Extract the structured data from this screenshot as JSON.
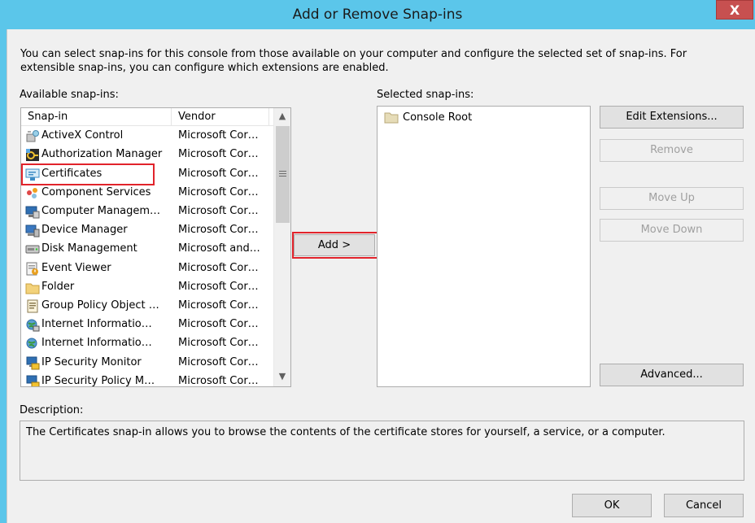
{
  "window": {
    "title": "Add or Remove Snap-ins",
    "close_label": "X"
  },
  "intro_text": "You can select snap-ins for this console from those available on your computer and configure the selected set of snap-ins. For extensible snap-ins, you can configure which extensions are enabled.",
  "available": {
    "label": "Available snap-ins:",
    "columns": {
      "name": "Snap-in",
      "vendor": "Vendor"
    },
    "items": [
      {
        "name": "ActiveX Control",
        "vendor": "Microsoft Cor…",
        "icon": "activex-icon"
      },
      {
        "name": "Authorization Manager",
        "vendor": "Microsoft Cor…",
        "icon": "authorization-manager-icon"
      },
      {
        "name": "Certificates",
        "vendor": "Microsoft Cor…",
        "icon": "certificates-icon"
      },
      {
        "name": "Component Services",
        "vendor": "Microsoft Cor…",
        "icon": "component-services-icon"
      },
      {
        "name": "Computer Managem…",
        "vendor": "Microsoft Cor…",
        "icon": "computer-management-icon"
      },
      {
        "name": "Device Manager",
        "vendor": "Microsoft Cor…",
        "icon": "device-manager-icon"
      },
      {
        "name": "Disk Management",
        "vendor": "Microsoft and…",
        "icon": "disk-management-icon"
      },
      {
        "name": "Event Viewer",
        "vendor": "Microsoft Cor…",
        "icon": "event-viewer-icon"
      },
      {
        "name": "Folder",
        "vendor": "Microsoft Cor…",
        "icon": "folder-icon"
      },
      {
        "name": "Group Policy Object …",
        "vendor": "Microsoft Cor…",
        "icon": "group-policy-icon"
      },
      {
        "name": "Internet Informatio…",
        "vendor": "Microsoft Cor…",
        "icon": "iis-icon"
      },
      {
        "name": "Internet Informatio…",
        "vendor": "Microsoft Cor…",
        "icon": "iis-icon"
      },
      {
        "name": "IP Security Monitor",
        "vendor": "Microsoft Cor…",
        "icon": "ip-security-monitor-icon"
      },
      {
        "name": "IP Security Policy M…",
        "vendor": "Microsoft Cor…",
        "icon": "ip-security-policy-icon"
      }
    ]
  },
  "add_button": "Add >",
  "selected": {
    "label": "Selected snap-ins:",
    "items": [
      {
        "name": "Console Root",
        "icon": "folder-icon"
      }
    ]
  },
  "side_buttons": {
    "edit_extensions": "Edit Extensions...",
    "remove": "Remove",
    "move_up": "Move Up",
    "move_down": "Move Down",
    "advanced": "Advanced..."
  },
  "description": {
    "label": "Description:",
    "text": "The Certificates snap-in allows you to browse the contents of the certificate stores for yourself, a service, or a computer."
  },
  "footer": {
    "ok": "OK",
    "cancel": "Cancel"
  },
  "colors": {
    "title_bar": "#5bc6ea",
    "close_button": "#c75050",
    "highlight": "#e1232b"
  }
}
